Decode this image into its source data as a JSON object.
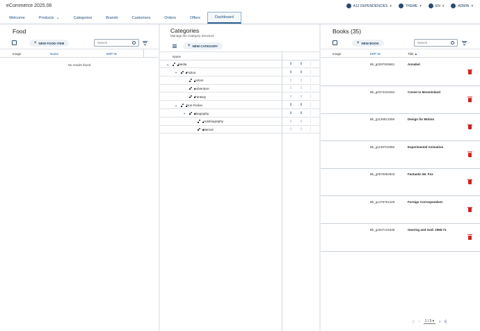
{
  "app": {
    "title": "eCommerce 2025.06"
  },
  "top_actions": [
    {
      "label": "A12 DEPENDENCIES",
      "icon": "info-icon"
    },
    {
      "label": "THEME",
      "icon": "palette-icon"
    },
    {
      "label": "EN",
      "icon": "globe-icon"
    },
    {
      "label": "ADMIN",
      "icon": "user-icon"
    }
  ],
  "nav": {
    "items": [
      {
        "label": "Welcome"
      },
      {
        "label": "Products",
        "has_dropdown": true
      },
      {
        "label": "Categories"
      },
      {
        "label": "Brands"
      },
      {
        "label": "Customers"
      },
      {
        "label": "Orders"
      },
      {
        "label": "Offers"
      },
      {
        "label": "Dashboard",
        "active": true
      }
    ]
  },
  "food": {
    "title": "Food",
    "new_label": "NEW FOOD ITEM",
    "search_placeholder": "Search",
    "columns": [
      "Image",
      "Name",
      "ERP ID"
    ],
    "empty_text": "No results found"
  },
  "categories": {
    "title": "Categories",
    "subtitle": "Manage the Category Structure",
    "new_label": "NEW CATEGORY",
    "column": "Name",
    "rows": [
      {
        "label": "Media",
        "level": 0,
        "expanded": true
      },
      {
        "label": "Fiction",
        "level": 1,
        "expanded": true
      },
      {
        "label": "Action",
        "level": 2
      },
      {
        "label": "Adventure",
        "level": 2
      },
      {
        "label": "Fantasy",
        "level": 2
      },
      {
        "label": "Non-Fiction",
        "level": 1,
        "expanded": true
      },
      {
        "label": "Biography",
        "level": 2,
        "expanded": true
      },
      {
        "label": "Autobiography",
        "level": 3
      },
      {
        "label": "Memoir",
        "level": 3
      }
    ]
  },
  "books": {
    "title": "Books (35)",
    "new_label": "NEW BOOK",
    "search_placeholder": "Search",
    "columns": [
      "Image",
      "ERP ID",
      "Title"
    ],
    "rows": [
      {
        "erp": "Bk_g0297829661",
        "title": "Annabel"
      },
      {
        "erp": "Bk_g0374315264",
        "title": "Comet in Moominland"
      },
      {
        "erp": "Bk_g1138812099",
        "title": "Design for Motion"
      },
      {
        "erp": "Bk_g1138702986",
        "title": "Experimental Animation"
      },
      {
        "erp": "Bk_g0670852503",
        "title": "Fantastic Mr. Fox"
      },
      {
        "erp": "Bk_g1476761329",
        "title": "Foreign Correspondent"
      },
      {
        "erp": "Bk_g1927131936",
        "title": "Geering and God: 1965-71"
      }
    ],
    "pager": {
      "page": "1 / 5"
    }
  }
}
